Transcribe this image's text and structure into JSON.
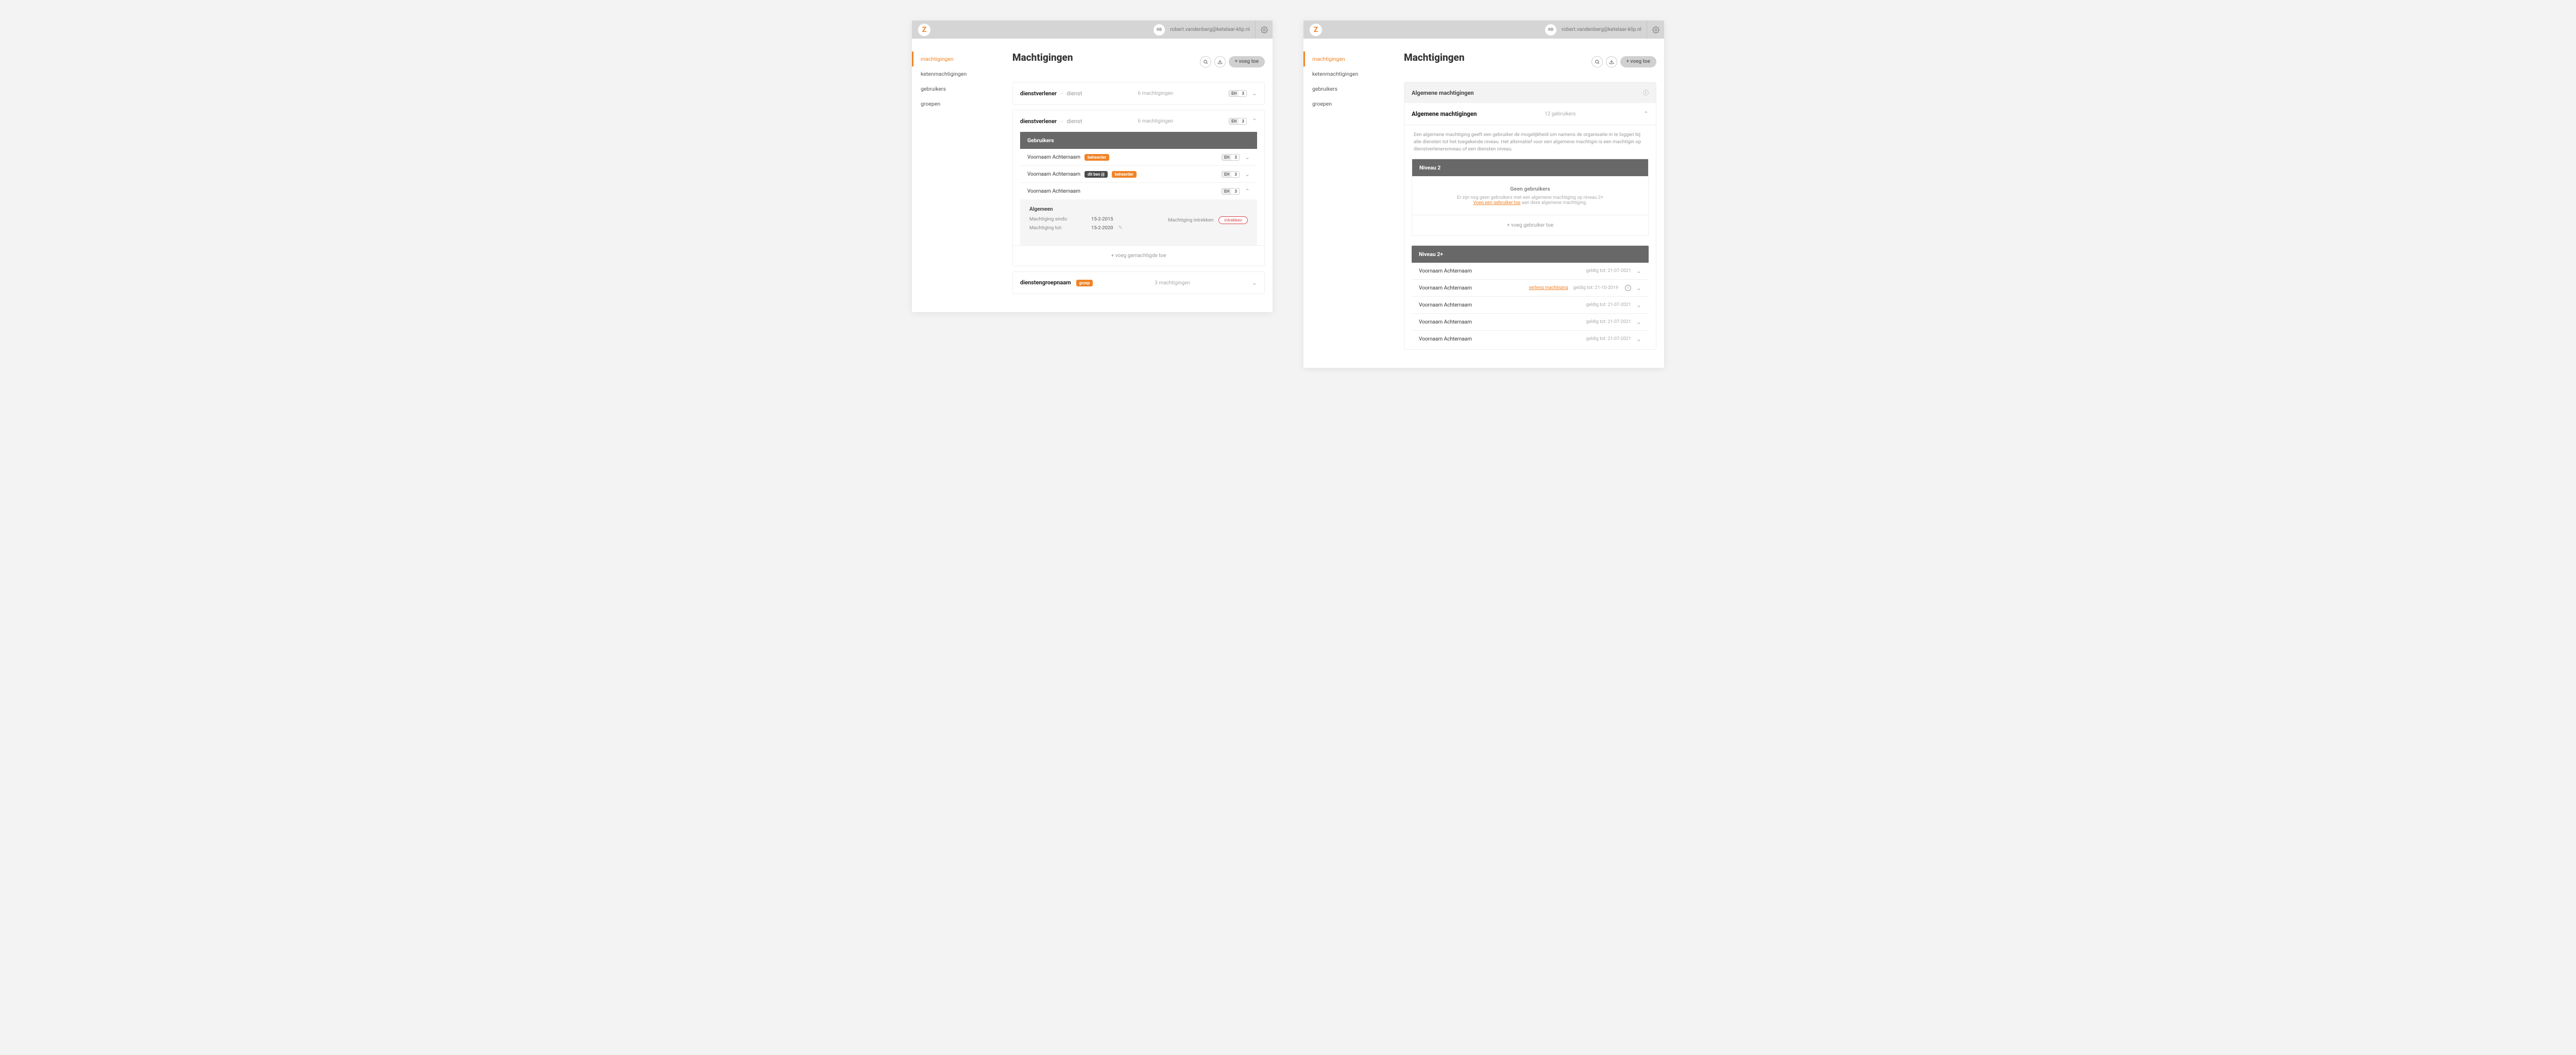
{
  "logo_letter": "Z",
  "user_initials": "RB",
  "user_email": "robert.vandenberg@ketelaar-klip.nl",
  "sidebar": {
    "items": [
      "machtigingen",
      "ketenmachtigingen",
      "gebruikers",
      "groepen"
    ]
  },
  "page_title": "Machtigingen",
  "add_button": "+ voeg toe",
  "left_screen": {
    "rows": [
      {
        "title": "dienstverlener",
        "sub": "dienst",
        "count": "6 machtigingen",
        "badge_left": "EH",
        "badge_right": "3"
      },
      {
        "title": "dienstverlener",
        "sub": "dienst",
        "count": "6 machtigingen",
        "badge_left": "EH",
        "badge_right": "3"
      }
    ],
    "users_header": "Gebruikers",
    "users": [
      {
        "name": "Voornaam Achternaam",
        "tags": [
          "beheerder"
        ],
        "badge_left": "EH",
        "badge_right": "3"
      },
      {
        "name": "Voornaam Achternaam",
        "tags": [
          "dit ben jij",
          "beheerder"
        ],
        "badge_left": "EH",
        "badge_right": "3"
      },
      {
        "name": "Voornaam Achternaam",
        "tags": [],
        "badge_left": "EH",
        "badge_right": "3"
      }
    ],
    "details": {
      "heading": "Algemeen",
      "since_label": "Machtiging sinds:",
      "since_value": "15-2-2015",
      "until_label": "Machtiging tot:",
      "until_value": "15-2-2020",
      "revoke_label": "Machtiging intrekken",
      "revoke_button": "intrekken"
    },
    "add_authorized": "+ voeg gemachtigde toe",
    "group_row": {
      "title": "dienstengroepnaam",
      "tag": "groep",
      "count": "3 machtigingen"
    }
  },
  "right_screen": {
    "banner": "Algemene machtigingen",
    "section_title": "Algemene machtigingen",
    "section_count": "12 gebruikers",
    "description": "Een algemene machtiging geeft een gebruiker de mogelijkheid om namens de organisatie in te loggen bij alle diensten tot het toegekende niveau. Het alternatief voor een algemene machtigin is een machtigin op dienstverlenersniveau of een diensten niveau.",
    "level2": {
      "title": "Niveau 2",
      "empty_title": "Geen gebruikers",
      "empty_line": "Er zijn nog geen gebruikers met een algemene machtiging op niveau 2+",
      "empty_link": "Voeg een gebruiker toe",
      "empty_tail": " aan deze algemene machtiging.",
      "add_user": "+ voeg gebruiker toe"
    },
    "level2p": {
      "title": "Niveau 2+",
      "rows": [
        {
          "name": "Voornaam Achternaam",
          "valid": "geldig tot: 21-07-2021"
        },
        {
          "name": "Voornaam Achternaam",
          "extend": "verleng machtiging",
          "valid": "geldig tot: 21-10-2019",
          "warn": true
        },
        {
          "name": "Voornaam Achternaam",
          "valid": "geldig tot: 21-07-2021"
        },
        {
          "name": "Voornaam Achternaam",
          "valid": "geldig tot: 21-07-2021"
        },
        {
          "name": "Voornaam Achternaam",
          "valid": "geldig tot: 21-07-2021"
        }
      ]
    }
  }
}
